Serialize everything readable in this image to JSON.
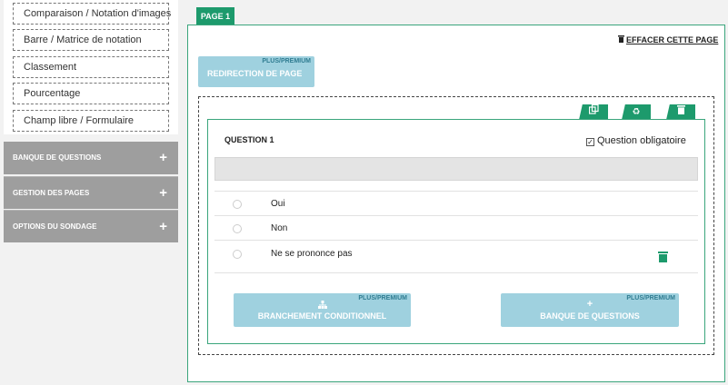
{
  "sidebar": {
    "tools": [
      {
        "label": "Comparaison / Notation d'images"
      },
      {
        "label": "Barre / Matrice de notation"
      },
      {
        "label": "Classement"
      },
      {
        "label": "Pourcentage"
      },
      {
        "label": "Champ libre / Formulaire"
      }
    ],
    "sections": [
      {
        "label": "BANQUE DE QUESTIONS",
        "icon": "plus-icon"
      },
      {
        "label": "GESTION DES PAGES",
        "icon": "plus-icon"
      },
      {
        "label": "OPTIONS DU SONDAGE",
        "icon": "plus-icon"
      }
    ]
  },
  "page": {
    "tab_label": "PAGE 1",
    "erase_label": "EFFACER CETTE PAGE",
    "redirect": {
      "tag": "PLUS/PREMIUM",
      "label": "REDIRECTION DE PAGE"
    }
  },
  "question": {
    "title": "QUESTION 1",
    "mandatory_label": "Question obligatoire",
    "mandatory_checked": true,
    "tab_icons": [
      "copy-icon",
      "recycle-icon",
      "trash-icon"
    ],
    "options": [
      {
        "label": "Oui"
      },
      {
        "label": "Non"
      },
      {
        "label": "Ne se prononce pas"
      }
    ],
    "conditional": {
      "tag": "PLUS/PREMIUM",
      "label": "BRANCHEMENT CONDITIONNEL",
      "icon": "sitemap-icon"
    },
    "bank": {
      "tag": "PLUS/PREMIUM",
      "label": "BANQUE DE QUESTIONS",
      "icon": "plus-icon"
    }
  },
  "colors": {
    "accent": "#1d9a6c",
    "premium": "#9fd1df",
    "sidebar_section": "#9e9e9e"
  }
}
